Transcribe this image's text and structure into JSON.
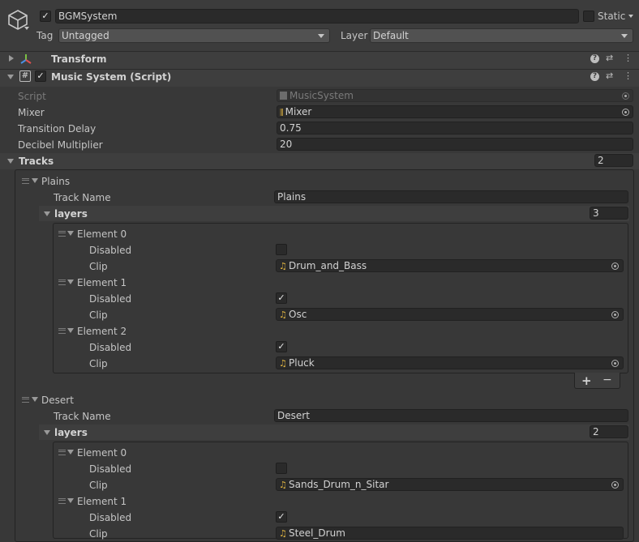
{
  "object": {
    "name": "BGMSystem",
    "static_label": "Static",
    "tag_label": "Tag",
    "tag_value": "Untagged",
    "layer_label": "Layer",
    "layer_value": "Default"
  },
  "components": {
    "transform": {
      "title": "Transform"
    },
    "music_system": {
      "title": "Music System (Script)"
    }
  },
  "properties": {
    "script": {
      "label": "Script",
      "value": "MusicSystem"
    },
    "mixer": {
      "label": "Mixer",
      "value": "Mixer"
    },
    "transition_delay": {
      "label": "Transition Delay",
      "value": "0.75"
    },
    "decibel_multiplier": {
      "label": "Decibel Multiplier",
      "value": "20"
    },
    "tracks": {
      "label": "Tracks",
      "count": "2"
    }
  },
  "tracks": [
    {
      "name": "Plains",
      "track_name_label": "Track Name",
      "track_name_value": "Plains",
      "layers_label": "layers",
      "layers_count": "3",
      "elements": [
        {
          "title": "Element 0",
          "disabled_label": "Disabled",
          "disabled": false,
          "clip_label": "Clip",
          "clip": "Drum_and_Bass"
        },
        {
          "title": "Element 1",
          "disabled_label": "Disabled",
          "disabled": true,
          "clip_label": "Clip",
          "clip": "Osc"
        },
        {
          "title": "Element 2",
          "disabled_label": "Disabled",
          "disabled": true,
          "clip_label": "Clip",
          "clip": "Pluck"
        }
      ]
    },
    {
      "name": "Desert",
      "track_name_label": "Track Name",
      "track_name_value": "Desert",
      "layers_label": "layers",
      "layers_count": "2",
      "elements": [
        {
          "title": "Element 0",
          "disabled_label": "Disabled",
          "disabled": false,
          "clip_label": "Clip",
          "clip": "Sands_Drum_n_Sitar"
        },
        {
          "title": "Element 1",
          "disabled_label": "Disabled",
          "disabled": true,
          "clip_label": "Clip",
          "clip": "Steel_Drum"
        }
      ]
    }
  ],
  "list_buttons": {
    "add": "+",
    "remove": "−"
  },
  "glyphs": {
    "check": "✓",
    "help": "?",
    "settings": "⇄",
    "more": "⋮",
    "note": "♫"
  },
  "colors": {
    "background": "#383838",
    "field": "#2a2a2a",
    "header": "#3e3e3e",
    "note": "#e1b541"
  },
  "icons": [
    "gameobject-cube-icon",
    "transform-axes-icon",
    "script-hash-icon",
    "audio-mixer-icon",
    "audio-clip-icon",
    "object-picker-icon"
  ]
}
